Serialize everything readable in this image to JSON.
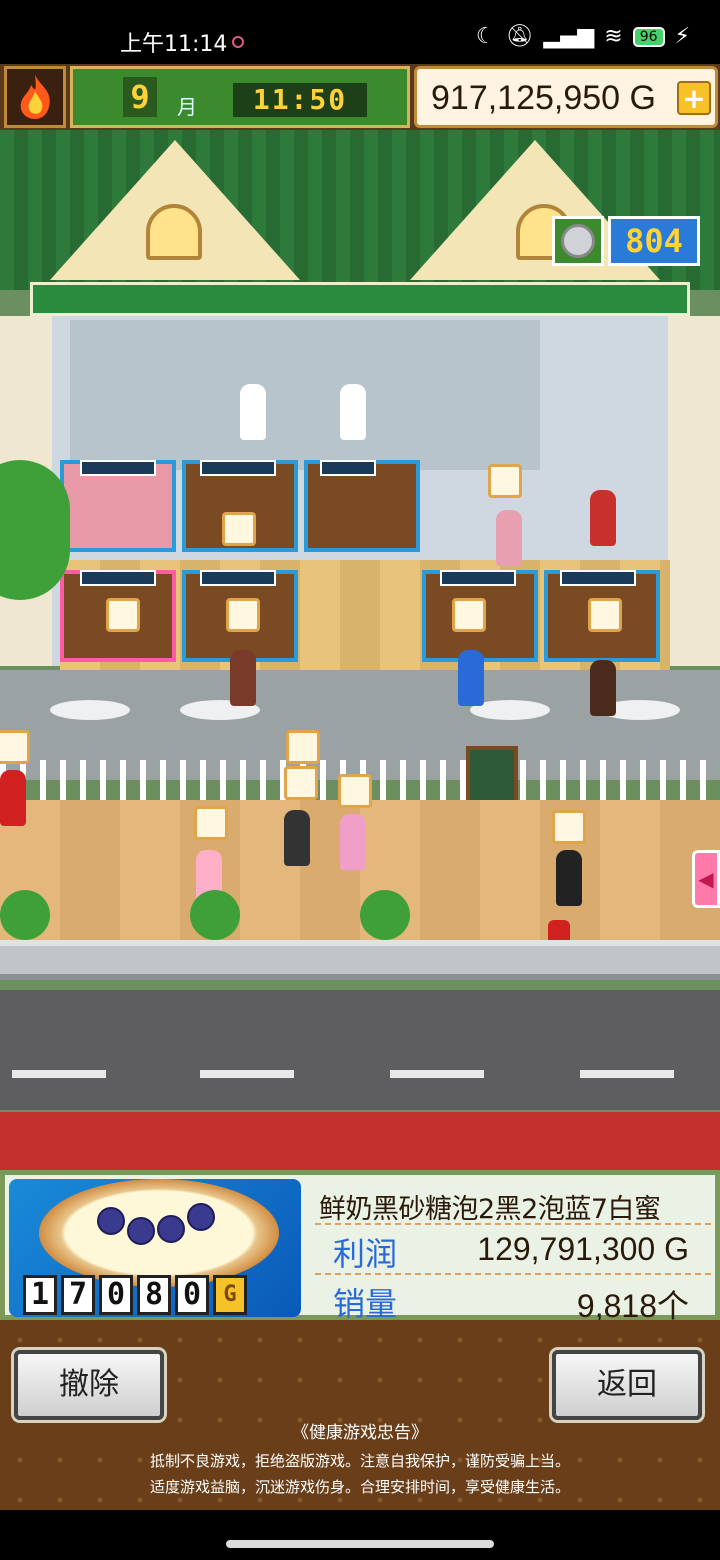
{
  "status_bar": {
    "time": "上午11:14",
    "battery": "96"
  },
  "hud": {
    "month": "9",
    "month_label": "月",
    "clock": "11:50",
    "money": "917,125,950 G",
    "plus_label": "+"
  },
  "scene": {
    "rank": "804"
  },
  "product_panel": {
    "name": "鲜奶黑砂糖泡2黑2泡蓝7白蜜",
    "profit_label": "利润",
    "profit_value": "129,791,300 G",
    "sales_label": "销量",
    "sales_value": "9,818个",
    "price_digits": [
      "1",
      "7",
      "0",
      "8",
      "0"
    ],
    "price_unit": "G"
  },
  "buttons": {
    "remove": "撤除",
    "back": "返回"
  },
  "health_advice": {
    "title": "《健康游戏忠告》",
    "line1": "抵制不良游戏，拒绝盗版游戏。注意自我保护，谨防受骗上当。",
    "line2": "适度游戏益脑，沉迷游戏伤身。合理安排时间，享受健康生活。"
  }
}
